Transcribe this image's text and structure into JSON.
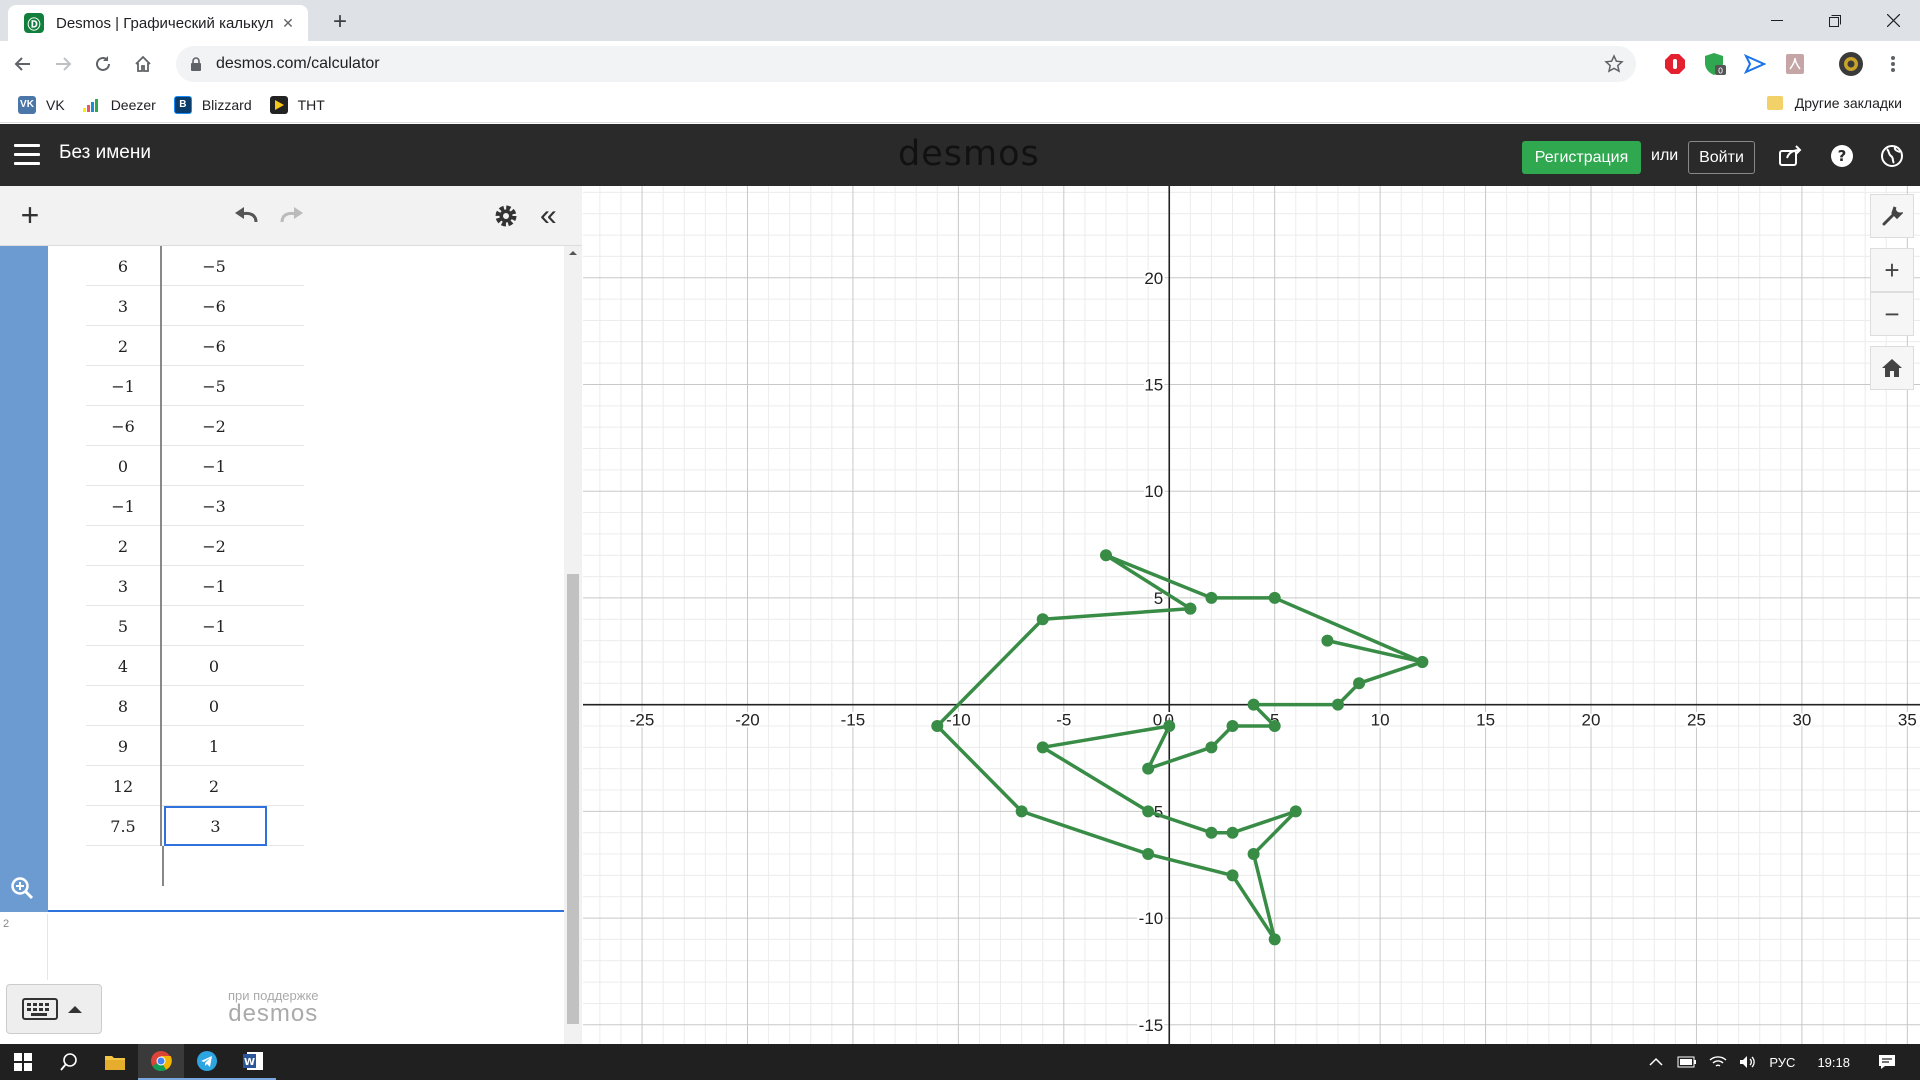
{
  "browser": {
    "tab_title": "Desmos | Графический калькул",
    "url": "desmos.com/calculator",
    "bookmarks": [
      {
        "label": "VK",
        "icon": "vk-icon",
        "color": "#4a76a8"
      },
      {
        "label": "Deezer",
        "icon": "deezer-icon",
        "color": "#ef5466"
      },
      {
        "label": "Blizzard",
        "icon": "blizzard-icon",
        "color": "#148eff"
      },
      {
        "label": "ТНТ",
        "icon": "tnt-icon",
        "color": "#222222"
      }
    ],
    "other_bookmarks": "Другие закладки"
  },
  "app": {
    "graph_title": "Без имени",
    "logo": "desmos",
    "register_label": "Регистрация",
    "or_label": "или",
    "login_label": "Войти",
    "accent": "#2fa84f"
  },
  "expressions": {
    "table_rows": [
      {
        "x": "6",
        "y": "−5"
      },
      {
        "x": "3",
        "y": "−6"
      },
      {
        "x": "2",
        "y": "−6"
      },
      {
        "x": "−1",
        "y": "−5"
      },
      {
        "x": "−6",
        "y": "−2"
      },
      {
        "x": "0",
        "y": "−1"
      },
      {
        "x": "−1",
        "y": "−3"
      },
      {
        "x": "2",
        "y": "−2"
      },
      {
        "x": "3",
        "y": "−1"
      },
      {
        "x": "5",
        "y": "−1"
      },
      {
        "x": "4",
        "y": "0"
      },
      {
        "x": "8",
        "y": "0"
      },
      {
        "x": "9",
        "y": "1"
      },
      {
        "x": "12",
        "y": "2"
      },
      {
        "x": "7.5",
        "y": "3"
      }
    ],
    "next_row_number": "2",
    "powered_by": "при поддержке",
    "powered_logo": "desmos"
  },
  "chart_data": {
    "type": "line",
    "line_color": "#388c46",
    "xlim": [
      -27.8,
      35.6
    ],
    "ylim": [
      -15.9,
      24.3
    ],
    "x_ticks": [
      -25,
      -20,
      -15,
      -10,
      -5,
      0,
      5,
      10,
      15,
      20,
      25,
      30,
      35
    ],
    "y_ticks": [
      -15,
      -10,
      -5,
      5,
      10,
      15,
      20
    ],
    "grid": true,
    "points": [
      [
        1,
        4.5
      ],
      [
        -6,
        4
      ],
      [
        -11,
        -1
      ],
      [
        -7,
        -5
      ],
      [
        -1,
        -7
      ],
      [
        3,
        -8
      ],
      [
        5,
        -11
      ],
      [
        4,
        -7
      ],
      [
        6,
        -5
      ],
      [
        3,
        -6
      ],
      [
        2,
        -6
      ],
      [
        -1,
        -5
      ],
      [
        -6,
        -2
      ],
      [
        0,
        -1
      ],
      [
        -1,
        -3
      ],
      [
        2,
        -2
      ],
      [
        3,
        -1
      ],
      [
        5,
        -1
      ],
      [
        4,
        0
      ],
      [
        8,
        0
      ],
      [
        9,
        1
      ],
      [
        12,
        2
      ],
      [
        7.5,
        3
      ],
      [
        12,
        2
      ],
      [
        5,
        5
      ],
      [
        2,
        5
      ],
      [
        -3,
        7
      ],
      [
        1,
        4.5
      ]
    ]
  },
  "taskbar": {
    "lang": "РУС",
    "time": "19:18"
  }
}
